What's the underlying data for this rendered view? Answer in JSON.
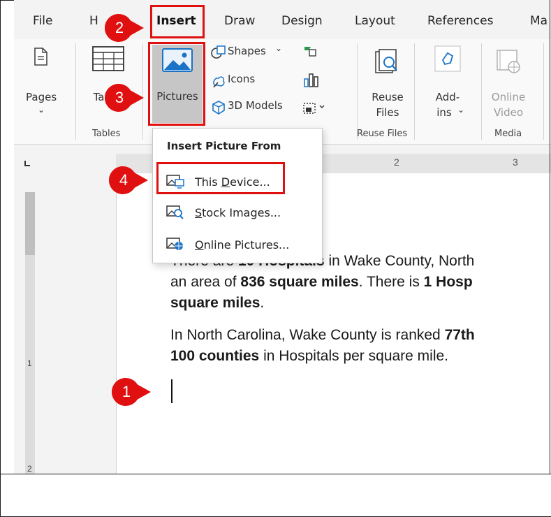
{
  "tabs": [
    "File",
    "H",
    "Insert",
    "Draw",
    "Design",
    "Layout",
    "References",
    "Ma"
  ],
  "ribbon": {
    "pages_label": "Pages",
    "table_label": "Table",
    "tables_group": "Tables",
    "pictures_label": "Pictures",
    "shapes_label": "Shapes",
    "icons_label": "Icons",
    "models_label": "3D Models",
    "reuse_label_1": "Reuse",
    "reuse_label_2": "Files",
    "reuse_group": "Reuse Files",
    "addins_label_1": "Add-",
    "addins_label_2": "ins",
    "online_video_1": "Online",
    "online_video_2": "Video",
    "media_group": "Media"
  },
  "ruler": {
    "mark2": "2",
    "mark3": "3",
    "mark1v": "1",
    "mark2v": "2"
  },
  "dropdown": {
    "title": "Insert Picture From",
    "items": [
      {
        "pre": "This ",
        "accel": "D",
        "post": "evice..."
      },
      {
        "pre": "",
        "accel": "S",
        "post": "tock Images..."
      },
      {
        "pre": "",
        "accel": "O",
        "post": "nline Pictures..."
      }
    ]
  },
  "document": {
    "p1_l1_a": "There are ",
    "p1_l1_b": "10 Hospitals",
    "p1_l1_c": " in Wake County, North",
    "p1_l2_a": "an area of ",
    "p1_l2_b": "836 square miles",
    "p1_l2_c": ". There is ",
    "p1_l2_d": "1 Hosp",
    "p1_l3_a": "square miles",
    "p1_l3_b": ".",
    "p2_l1_a": "In North Carolina, Wake County is ranked ",
    "p2_l1_b": "77th",
    "p2_l2_a": "100 counties",
    "p2_l2_b": " in Hospitals per square mile."
  },
  "steps": [
    "1",
    "2",
    "3",
    "4"
  ],
  "colors": {
    "accent_red": "#e01010",
    "tab_blue": "#1a73c7"
  }
}
